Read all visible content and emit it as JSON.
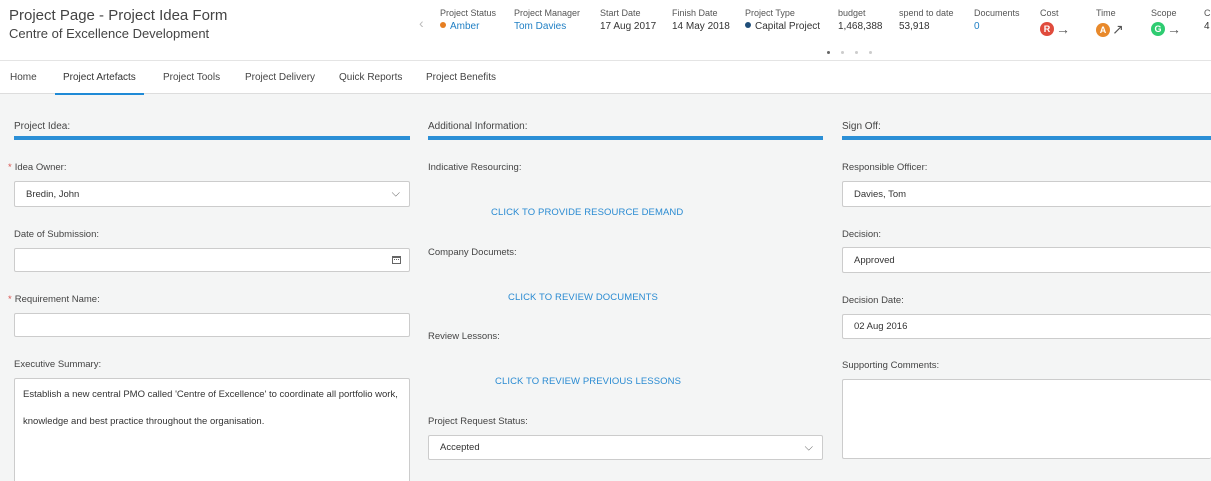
{
  "header": {
    "title": "Project Page - Project Idea Form",
    "subtitle": "Centre of Excellence Development"
  },
  "kpis": {
    "project_status": {
      "label": "Project Status",
      "value": "Amber",
      "color": "#e67e22"
    },
    "project_manager": {
      "label": "Project Manager",
      "value": "Tom Davies"
    },
    "start_date": {
      "label": "Start Date",
      "value": "17 Aug 2017"
    },
    "finish_date": {
      "label": "Finish Date",
      "value": "14 May 2018"
    },
    "project_type": {
      "label": "Project Type",
      "value": "Capital Project",
      "color": "#1f4e79"
    },
    "budget": {
      "label": "budget",
      "value": "1,468,388"
    },
    "spend_to_date": {
      "label": "spend to date",
      "value": "53,918"
    },
    "documents": {
      "label": "Documents",
      "value": "0"
    },
    "cost": {
      "label": "Cost",
      "rag": "R",
      "color": "#e04b3c",
      "trend": "→"
    },
    "time": {
      "label": "Time",
      "rag": "A",
      "color": "#e8892b",
      "trend": "↗"
    },
    "scope": {
      "label": "Scope",
      "rag": "G",
      "color": "#2ecc71",
      "trend": "→"
    },
    "overflow": {
      "label": "C",
      "value": "4"
    }
  },
  "tabs": [
    {
      "label": "Home"
    },
    {
      "label": "Project Artefacts"
    },
    {
      "label": "Project Tools"
    },
    {
      "label": "Project Delivery"
    },
    {
      "label": "Quick Reports"
    },
    {
      "label": "Project Benefits"
    }
  ],
  "project_idea": {
    "title": "Project Idea:",
    "idea_owner_label": "Idea Owner:",
    "idea_owner_value": "Bredin, John",
    "date_submission_label": "Date of Submission:",
    "date_submission_value": "",
    "requirement_name_label": "Requirement Name:",
    "requirement_name_value": "",
    "exec_summary_label": "Executive Summary:",
    "exec_summary_lines": [
      "Establish a new central PMO called 'Centre of Excellence' to coordinate all portfolio work,",
      "knowledge and best practice throughout the organisation."
    ]
  },
  "additional_info": {
    "title": "Additional Information:",
    "resourcing_label": "Indicative Resourcing:",
    "resourcing_link": "CLICK TO PROVIDE RESOURCE DEMAND",
    "documents_label": "Company Documets:",
    "documents_link": "CLICK TO REVIEW DOCUMENTS",
    "lessons_label": "Review Lessons:",
    "lessons_link": "CLICK TO REVIEW PREVIOUS LESSONS",
    "request_status_label": "Project Request Status:",
    "request_status_value": "Accepted"
  },
  "sign_off": {
    "title": "Sign Off:",
    "officer_label": "Responsible Officer:",
    "officer_value": "Davies, Tom",
    "decision_label": "Decision:",
    "decision_value": "Approved",
    "decision_date_label": "Decision Date:",
    "decision_date_value": "02 Aug 2016",
    "comments_label": "Supporting Comments:",
    "comments_value": ""
  }
}
